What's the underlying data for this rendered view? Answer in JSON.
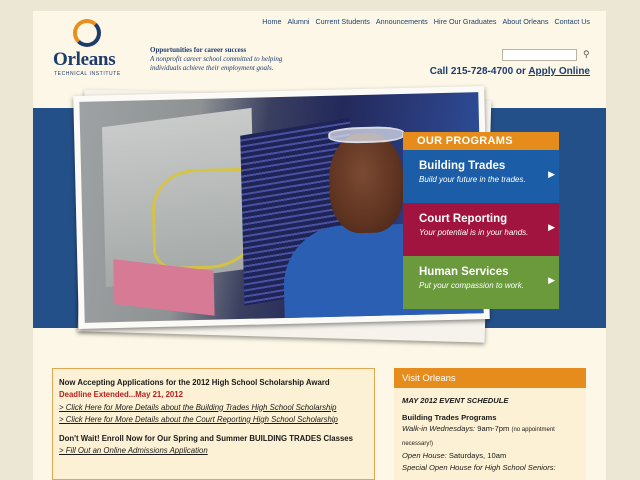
{
  "nav": [
    "Home",
    "Alumni",
    "Current Students",
    "Announcements",
    "Hire Our Graduates",
    "About Orleans",
    "Contact Us"
  ],
  "logo": {
    "name": "Orleans",
    "subtitle": "TECHNICAL INSTITUTE"
  },
  "tagline": {
    "headline": "Opportunities for career success",
    "line1": "A nonprofit career school committed to helping",
    "line2": "individuals achieve their employment goals."
  },
  "search": {
    "placeholder": "",
    "icon": "search-icon"
  },
  "contact": {
    "call_text": "Call 215-728-4700 or ",
    "apply_link": "Apply Online"
  },
  "programs": {
    "heading": "OUR PROGRAMS",
    "items": [
      {
        "title": "Building Trades",
        "desc": "Build your future in the trades.",
        "color": "#1b5ea7"
      },
      {
        "title": "Court Reporting",
        "desc": "Your potential is in your hands.",
        "color": "#a1143f"
      },
      {
        "title": "Human Services",
        "desc": "Put your compassion to work.",
        "color": "#6b9a3c"
      }
    ]
  },
  "announcements": {
    "headline": "Now Accepting Applications for the 2012 High School Scholarship Award",
    "deadline": "Deadline Extended...May 21, 2012",
    "link1": "> Click Here for More Details about the Building Trades High School Scholarship",
    "link2": "> Click Here for More Details about the Court Reporting High School Scholarship",
    "enroll": "Don't Wait! Enroll Now for Our Spring and Summer BUILDING TRADES Classes",
    "link3": "> Fill Out an Online Admissions Application"
  },
  "visit": {
    "heading": "Visit Orleans",
    "schedule_title": "MAY 2012 EVENT SCHEDULE",
    "program": "Building Trades Programs",
    "walkin_label": "Walk-in Wednesdays:",
    "walkin_time": " 9am-7pm ",
    "walkin_note": "(no appointment necessary!)",
    "openhouse_label": "Open House:",
    "openhouse_time": " Saturdays, 10am",
    "special": "Special Open House for High School Seniors:"
  },
  "colors": {
    "accent_orange": "#e58c1c",
    "navy": "#1e3b6e",
    "band_blue": "#245089"
  }
}
